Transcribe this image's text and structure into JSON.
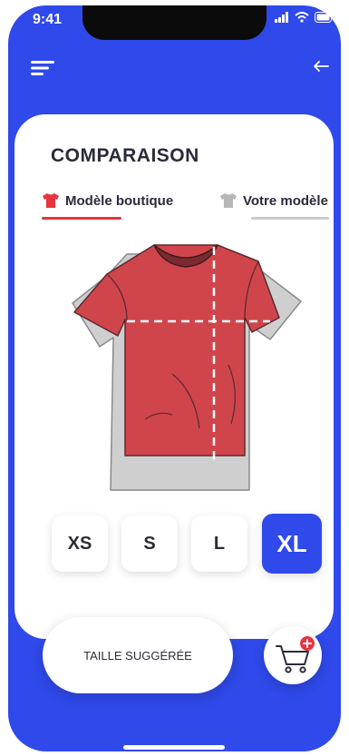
{
  "status": {
    "time": "9:41"
  },
  "header": {
    "menu_icon": "menu-icon",
    "back_icon": "back-arrow-icon"
  },
  "main": {
    "title": "COMPARAISON",
    "tabs": [
      {
        "label": "Modèle boutique",
        "icon": "tshirt-icon",
        "color": "#e7343f",
        "active": true
      },
      {
        "label": "Votre modèle",
        "icon": "tshirt-icon",
        "color": "#b7b7b7",
        "active": false
      }
    ],
    "sizes": [
      {
        "label": "XS",
        "selected": false
      },
      {
        "label": "S",
        "selected": false
      },
      {
        "label": "L",
        "selected": false
      },
      {
        "label": "XL",
        "selected": true
      }
    ]
  },
  "footer": {
    "suggest_label": "TAILLE SUGGÉRÉE",
    "cart_icon": "cart-add-icon"
  },
  "colors": {
    "accent": "#2f49ea",
    "shop_model": "#e7343f",
    "user_model": "#c9c9c9"
  }
}
